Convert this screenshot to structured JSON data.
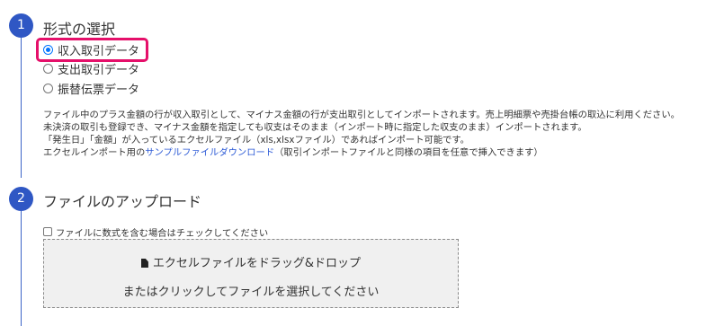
{
  "steps": [
    {
      "number": "1",
      "title": "形式の選択",
      "options": [
        {
          "label": "収入取引データ",
          "checked": true
        },
        {
          "label": "支出取引データ",
          "checked": false
        },
        {
          "label": "振替伝票データ",
          "checked": false
        }
      ],
      "description": {
        "line1": "ファイル中のプラス金額の行が収入取引として、マイナス金額の行が支出取引としてインポートされます。売上明細票や売掛台帳の取込に利用ください。",
        "line2": "未決済の取引も登録でき、マイナス金額を指定しても収支はそのまま（インポート時に指定した収支のまま）インポートされます。",
        "line3": "「発生日」「金額」が入っているエクセルファイル（xls,xlsxファイル）であればインポート可能です。",
        "line4_prefix": "エクセルインポート用の",
        "line4_link": "サンプルファイルダウンロード",
        "line4_suffix": "（取引インポートファイルと同様の項目を任意で挿入できます）"
      }
    },
    {
      "number": "2",
      "title": "ファイルのアップロード",
      "checkbox_label": "ファイルに数式を含む場合はチェックしてください",
      "checkbox_checked": false,
      "dropzone": {
        "icon": "file-icon",
        "line1": "エクセルファイルをドラッグ&ドロップ",
        "line2": "またはクリックしてファイルを選択してください"
      }
    }
  ],
  "colors": {
    "step_circle": "#2f57c4",
    "highlight": "#e5106a",
    "link": "#2d5bd6",
    "radio_checked": "#0075ff"
  }
}
